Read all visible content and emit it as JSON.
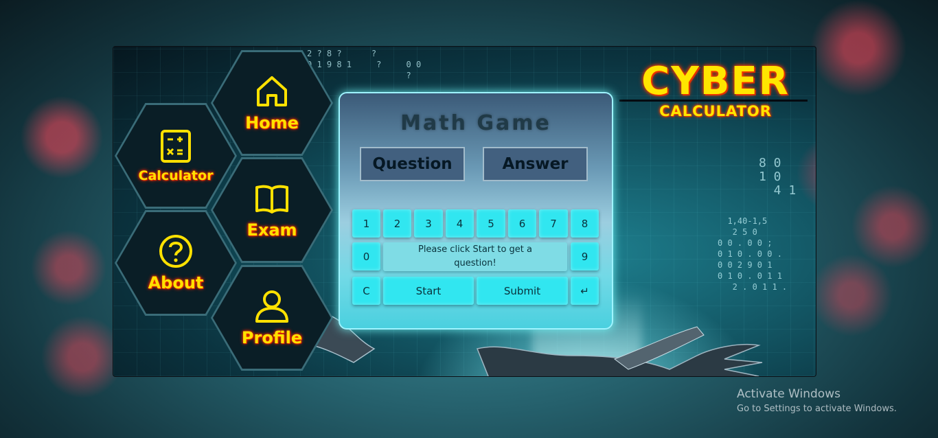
{
  "brand": {
    "title": "CYBER",
    "subtitle": "CALCULATOR",
    "color": "#ffe600"
  },
  "nav": {
    "home": {
      "label": "Home",
      "icon": "home-icon"
    },
    "calculator": {
      "label": "Calculator",
      "icon": "calculator-icon"
    },
    "exam": {
      "label": "Exam",
      "icon": "book-icon"
    },
    "about": {
      "label": "About",
      "icon": "question-icon"
    },
    "profile": {
      "label": "Profile",
      "icon": "user-icon"
    }
  },
  "game": {
    "title": "Math Game",
    "question_label": "Question",
    "answer_label": "Answer",
    "message": "Please click Start to get a question!",
    "keys": {
      "k1": "1",
      "k2": "2",
      "k3": "3",
      "k4": "4",
      "k5": "5",
      "k6": "6",
      "k7": "7",
      "k8": "8",
      "k0": "0",
      "k9": "9",
      "clear": "C",
      "start": "Start",
      "submit": "Submit",
      "enter": "↵"
    }
  },
  "watermark": {
    "line1": "Activate Windows",
    "line2": "Go to Settings to activate Windows."
  },
  "colors": {
    "accent": "#31e6f0",
    "label_yellow": "#ffe100",
    "label_glow": "#ff2a00"
  }
}
